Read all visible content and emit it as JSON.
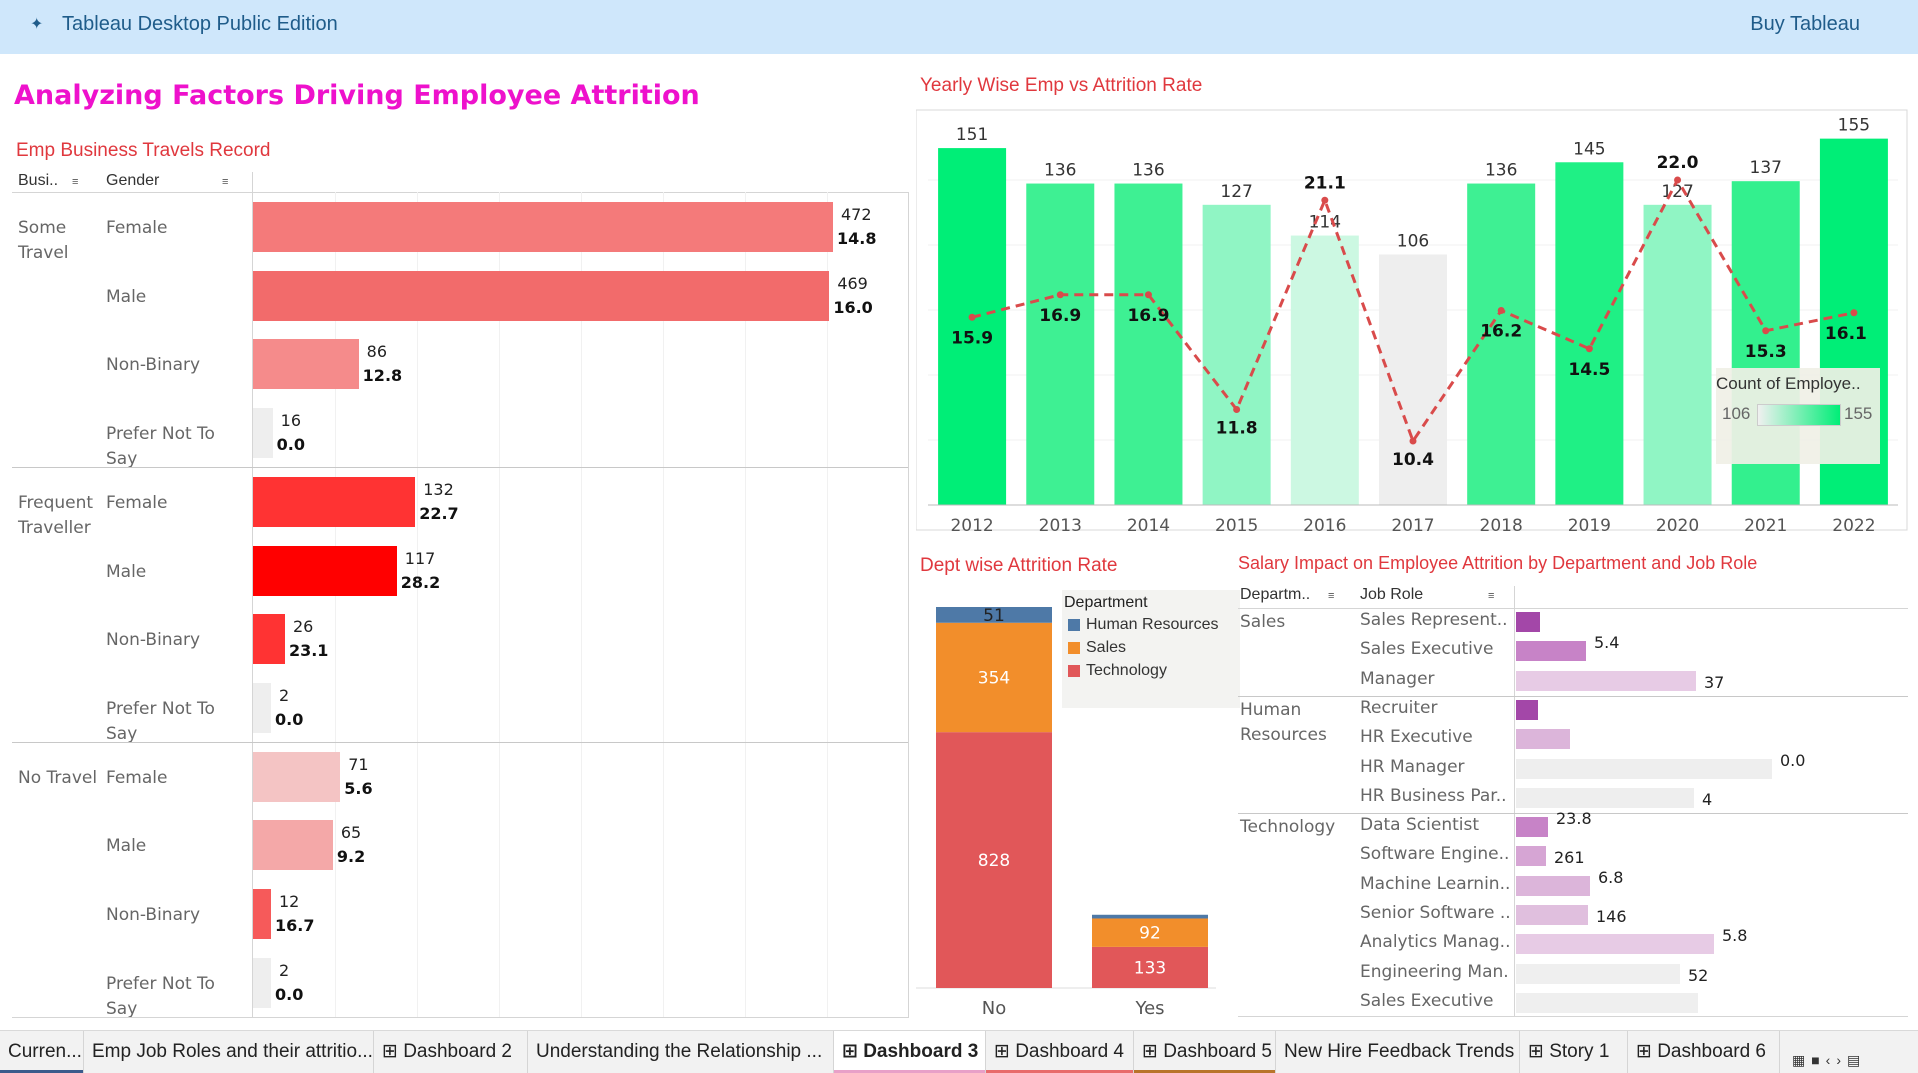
{
  "app": {
    "title": "Tableau Desktop Public Edition",
    "buy": "Buy Tableau",
    "logo_icon": "tableau-logo-icon"
  },
  "dashboard": {
    "title": "Analyzing Factors Driving Employee Attrition"
  },
  "travel": {
    "title": "Emp Business Travels Record",
    "col1": "Busi..",
    "col2": "Gender",
    "max_count": 472,
    "groups": [
      {
        "name": "Some Travel",
        "rows": [
          {
            "gender": "Female",
            "count": 472,
            "rate": "14.8",
            "color": "#f47a7a"
          },
          {
            "gender": "Male",
            "count": 469,
            "rate": "16.0",
            "color": "#f26b6b"
          },
          {
            "gender": "Non-Binary",
            "count": 86,
            "rate": "12.8",
            "color": "#f58b8b"
          },
          {
            "gender": "Prefer Not To Say",
            "count": 16,
            "rate": "0.0",
            "color": "#eeeeee"
          }
        ]
      },
      {
        "name": "Frequent Traveller",
        "rows": [
          {
            "gender": "Female",
            "count": 132,
            "rate": "22.7",
            "color": "#ff3333"
          },
          {
            "gender": "Male",
            "count": 117,
            "rate": "28.2",
            "color": "#ff0000"
          },
          {
            "gender": "Non-Binary",
            "count": 26,
            "rate": "23.1",
            "color": "#ff3333"
          },
          {
            "gender": "Prefer Not To Say",
            "count": 2,
            "rate": "0.0",
            "color": "#eeeeee"
          }
        ]
      },
      {
        "name": "No Travel",
        "rows": [
          {
            "gender": "Female",
            "count": 71,
            "rate": "5.6",
            "color": "#f4c4c4"
          },
          {
            "gender": "Male",
            "count": 65,
            "rate": "9.2",
            "color": "#f4a8a8"
          },
          {
            "gender": "Non-Binary",
            "count": 12,
            "rate": "16.7",
            "color": "#f65a5a"
          },
          {
            "gender": "Prefer Not To Say",
            "count": 2,
            "rate": "0.0",
            "color": "#eeeeee"
          }
        ]
      }
    ]
  },
  "yearly": {
    "title": "Yearly Wise Emp vs Attrition Rate",
    "legend_title": "Count of Employe..",
    "legend_min": "106",
    "legend_max": "155"
  },
  "dept": {
    "title": "Dept wise Attrition Rate",
    "legend_title": "Department",
    "legend": [
      {
        "name": "Human Resources",
        "color": "#4e79a7"
      },
      {
        "name": "Sales",
        "color": "#f28e2b"
      },
      {
        "name": "Technology",
        "color": "#e15759"
      }
    ]
  },
  "salary": {
    "title": "Salary Impact on Employee Attrition by Department and Job Role",
    "col1": "Departm..",
    "col2": "Job Role",
    "groups": [
      {
        "name": "Sales",
        "roles": [
          {
            "role": "Sales Represent..",
            "v": 0.12,
            "color": "#a347a8",
            "a": "",
            "b": ""
          },
          {
            "role": "Sales Executive",
            "v": 0.35,
            "color": "#c783c7",
            "a": "5.4",
            "b": ""
          },
          {
            "role": "Manager",
            "v": 0.9,
            "color": "#e7cbe5",
            "a": "",
            "b": "37"
          }
        ]
      },
      {
        "name": "Human Resources",
        "roles": [
          {
            "role": "Recruiter",
            "v": 0.11,
            "color": "#a347a8",
            "a": "",
            "b": ""
          },
          {
            "role": "HR Executive",
            "v": 0.27,
            "color": "#dcb5da",
            "a": "",
            "b": ""
          },
          {
            "role": "HR Manager",
            "v": 1.28,
            "color": "#eeeeee",
            "a": "0.0",
            "b": ""
          },
          {
            "role": "HR Business Par..",
            "v": 0.89,
            "color": "#eeeeee",
            "a": "",
            "b": "4"
          }
        ]
      },
      {
        "name": "Technology",
        "roles": [
          {
            "role": "Data Scientist",
            "v": 0.16,
            "color": "#c783c7",
            "a": "23.8",
            "b": ""
          },
          {
            "role": "Software Engine..",
            "v": 0.15,
            "color": "#d6a5d4",
            "a": "",
            "b": "261"
          },
          {
            "role": "Machine Learnin..",
            "v": 0.37,
            "color": "#dcb5da",
            "a": "6.8",
            "b": ""
          },
          {
            "role": "Senior Software ..",
            "v": 0.36,
            "color": "#e0bfde",
            "a": "",
            "b": "146"
          },
          {
            "role": "Analytics Manag..",
            "v": 0.99,
            "color": "#e7cbe5",
            "a": "5.8",
            "b": ""
          },
          {
            "role": "Engineering Man..",
            "v": 0.82,
            "color": "#efefef",
            "a": "",
            "b": "52"
          },
          {
            "role": "Sales Executive",
            "v": 0.91,
            "color": "#efefef",
            "a": "",
            "b": ""
          }
        ]
      }
    ]
  },
  "tabs": [
    {
      "label": "Curren...",
      "active": false,
      "underline": "#3b5b8c"
    },
    {
      "label": "Emp Job Roles and their attritio...",
      "active": false,
      "underline": ""
    },
    {
      "label": "⊞ Dashboard 2",
      "active": false,
      "underline": ""
    },
    {
      "label": "Understanding the Relationship ...",
      "active": false,
      "underline": ""
    },
    {
      "label": "⊞ Dashboard 3",
      "active": true,
      "underline": "#e8a0c8"
    },
    {
      "label": "⊞ Dashboard 4",
      "active": false,
      "underline": "#e86b6b"
    },
    {
      "label": "⊞ Dashboard 5",
      "active": false,
      "underline": "#b8742a"
    },
    {
      "label": "New Hire Feedback Trends",
      "active": false,
      "underline": ""
    },
    {
      "label": "⊞ Story 1",
      "active": false,
      "underline": ""
    },
    {
      "label": "⊞ Dashboard 6",
      "active": false,
      "underline": ""
    }
  ],
  "chart_data": [
    {
      "type": "bar",
      "title": "Yearly Wise Emp vs Attrition Rate",
      "categories": [
        "2012",
        "2013",
        "2014",
        "2015",
        "2016",
        "2017",
        "2018",
        "2019",
        "2020",
        "2021",
        "2022"
      ],
      "series": [
        {
          "name": "Count of Employe..",
          "values": [
            151,
            136,
            136,
            127,
            114,
            106,
            136,
            145,
            127,
            137,
            155
          ]
        }
      ],
      "line": [
        15.9,
        16.9,
        16.9,
        11.8,
        21.1,
        10.4,
        16.2,
        14.5,
        22.0,
        15.3,
        16.1
      ],
      "line_labels": [
        "15.9",
        "16.9",
        "16.9",
        "11.8",
        "21.1",
        "10.4",
        "16.2",
        "14.5",
        "22.0",
        "15.3",
        "16.1"
      ],
      "bar_colors": [
        "#00ee77",
        "#3ef093",
        "#3ef093",
        "#90f5c4",
        "#ccf8e2",
        "#eeeeee",
        "#3ef093",
        "#1ff085",
        "#90f5c4",
        "#33f08e",
        "#00ee77"
      ],
      "bar_dark_labels": [
        false,
        false,
        false,
        false,
        false,
        true,
        false,
        false,
        false,
        false,
        false
      ]
    },
    {
      "type": "bar",
      "title": "Dept wise Attrition Rate",
      "categories": [
        "No",
        "Yes"
      ],
      "series": [
        {
          "name": "Technology",
          "values": [
            828,
            133
          ]
        },
        {
          "name": "Sales",
          "values": [
            354,
            92
          ]
        },
        {
          "name": "Human Resources",
          "values": [
            51,
            12
          ]
        }
      ],
      "labels_shown": [
        [
          "828",
          "354",
          "51"
        ],
        [
          "133",
          "92",
          ""
        ]
      ]
    }
  ]
}
